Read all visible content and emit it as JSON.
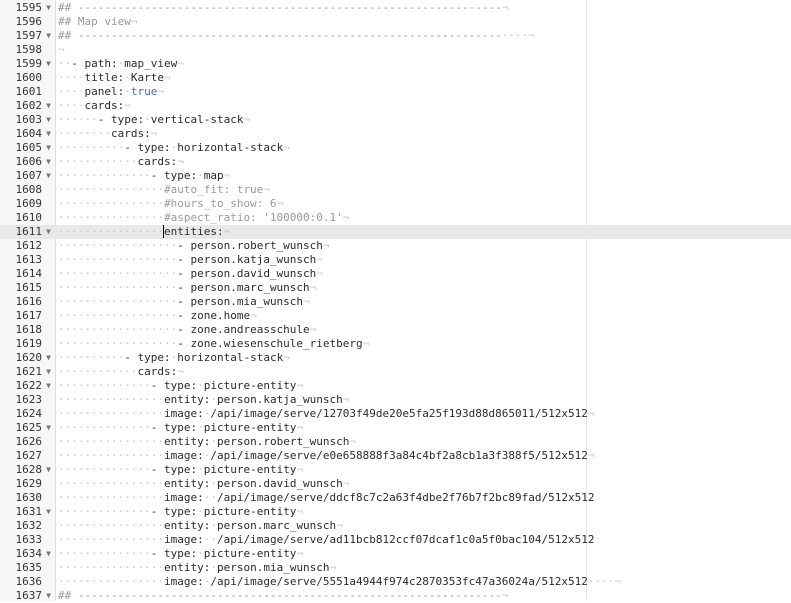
{
  "editor": {
    "lines": [
      {
        "n": "1595",
        "fold": true,
        "indent": 0,
        "c": "## ----------------------------------------------------------------",
        "eol": "¬"
      },
      {
        "n": "1596",
        "fold": false,
        "indent": 0,
        "c": "## Map view",
        "eol": "¬"
      },
      {
        "n": "1597",
        "fold": true,
        "indent": 0,
        "c": "## ----------------------------------------------------------------",
        "eol": "····¬"
      },
      {
        "n": "1598",
        "fold": false,
        "indent": 0,
        "eol": "¬"
      },
      {
        "n": "1599",
        "fold": true,
        "indent": 1,
        "d": "- ",
        "k": "path",
        "v": "map_view",
        "eol": "¬"
      },
      {
        "n": "1600",
        "fold": false,
        "indent": 2,
        "k": "title",
        "v": "Karte",
        "eol": "¬"
      },
      {
        "n": "1601",
        "fold": false,
        "indent": 2,
        "k": "panel",
        "b": "true",
        "eol": "¬"
      },
      {
        "n": "1602",
        "fold": true,
        "indent": 2,
        "k": "cards",
        "eol": "¬"
      },
      {
        "n": "1603",
        "fold": true,
        "indent": 3,
        "d": "- ",
        "k": "type",
        "v": "vertical-stack",
        "eol": "¬"
      },
      {
        "n": "1604",
        "fold": true,
        "indent": 4,
        "k": "cards",
        "eol": "¬"
      },
      {
        "n": "1605",
        "fold": true,
        "indent": 5,
        "d": "- ",
        "k": "type",
        "v": "horizontal-stack",
        "eol": "¬"
      },
      {
        "n": "1606",
        "fold": true,
        "indent": 6,
        "k": "cards",
        "eol": "¬"
      },
      {
        "n": "1607",
        "fold": true,
        "indent": 7,
        "d": "- ",
        "k": "type",
        "v": "map",
        "eol": "¬"
      },
      {
        "n": "1608",
        "fold": false,
        "indent": 8,
        "c": "#auto_fit: true",
        "eol": "¬"
      },
      {
        "n": "1609",
        "fold": false,
        "indent": 8,
        "c": "#hours_to_show: 6",
        "eol": "¬"
      },
      {
        "n": "1610",
        "fold": false,
        "indent": 8,
        "c": "#aspect_ratio: '100000:0.1'",
        "eol": "¬"
      },
      {
        "n": "1611",
        "fold": true,
        "indent": 8,
        "k": "entities",
        "active": true,
        "caret": true,
        "eol": "¬"
      },
      {
        "n": "1612",
        "fold": false,
        "indent": 9,
        "d": "- ",
        "v": "person.robert_wunsch",
        "eol": "¬"
      },
      {
        "n": "1613",
        "fold": false,
        "indent": 9,
        "d": "- ",
        "v": "person.katja_wunsch",
        "eol": "¬"
      },
      {
        "n": "1614",
        "fold": false,
        "indent": 9,
        "d": "- ",
        "v": "person.david_wunsch",
        "eol": "¬"
      },
      {
        "n": "1615",
        "fold": false,
        "indent": 9,
        "d": "- ",
        "v": "person.marc_wunsch",
        "eol": "¬"
      },
      {
        "n": "1616",
        "fold": false,
        "indent": 9,
        "d": "- ",
        "v": "person.mia_wunsch",
        "eol": "¬"
      },
      {
        "n": "1617",
        "fold": false,
        "indent": 9,
        "d": "- ",
        "v": "zone.home",
        "eol": "¬"
      },
      {
        "n": "1618",
        "fold": false,
        "indent": 9,
        "d": "- ",
        "v": "zone.andreasschule",
        "eol": "¬"
      },
      {
        "n": "1619",
        "fold": false,
        "indent": 9,
        "d": "- ",
        "v": "zone.wiesenschule_rietberg",
        "eol": "¬"
      },
      {
        "n": "1620",
        "fold": true,
        "indent": 5,
        "d": "- ",
        "k": "type",
        "v": "horizontal-stack",
        "eol": "¬"
      },
      {
        "n": "1621",
        "fold": true,
        "indent": 6,
        "k": "cards",
        "eol": "¬"
      },
      {
        "n": "1622",
        "fold": true,
        "indent": 7,
        "d": "- ",
        "k": "type",
        "v": "picture-entity",
        "eol": "¬"
      },
      {
        "n": "1623",
        "fold": false,
        "indent": 8,
        "k": "entity",
        "v": "person.katja_wunsch",
        "eol": "¬"
      },
      {
        "n": "1624",
        "fold": false,
        "indent": 8,
        "k": "image",
        "v": "/api/image/serve/12703f49de20e5fa25f193d88d865011/512x512",
        "eol": "¬"
      },
      {
        "n": "1625",
        "fold": true,
        "indent": 7,
        "d": "- ",
        "k": "type",
        "v": "picture-entity",
        "eol": "¬"
      },
      {
        "n": "1626",
        "fold": false,
        "indent": 8,
        "k": "entity",
        "v": "person.robert_wunsch",
        "eol": "¬"
      },
      {
        "n": "1627",
        "fold": false,
        "indent": 8,
        "k": "image",
        "v": "/api/image/serve/e0e658888f3a84c4bf2a8cb1a3f388f5/512x512",
        "eol": "¬"
      },
      {
        "n": "1628",
        "fold": true,
        "indent": 7,
        "d": "- ",
        "k": "type",
        "v": "picture-entity",
        "eol": "¬"
      },
      {
        "n": "1629",
        "fold": false,
        "indent": 8,
        "k": "entity",
        "v": "person.david_wunsch",
        "eol": "¬"
      },
      {
        "n": "1630",
        "fold": false,
        "indent": 8,
        "k": "image",
        "sp": "··",
        "v": "/api/image/serve/ddcf8c7c2a63f4dbe2f76b7f2bc89fad/512x512",
        "eol": ""
      },
      {
        "n": "1631",
        "fold": true,
        "indent": 7,
        "d": "- ",
        "k": "type",
        "v": "picture-entity",
        "eol": "¬"
      },
      {
        "n": "1632",
        "fold": false,
        "indent": 8,
        "k": "entity",
        "v": "person.marc_wunsch",
        "eol": "¬"
      },
      {
        "n": "1633",
        "fold": false,
        "indent": 8,
        "k": "image",
        "sp": "··",
        "v": "/api/image/serve/ad11bcb812ccf07dcaf1c0a5f0bac104/512x512",
        "eol": ""
      },
      {
        "n": "1634",
        "fold": true,
        "indent": 7,
        "d": "- ",
        "k": "type",
        "v": "picture-entity",
        "eol": "¬"
      },
      {
        "n": "1635",
        "fold": false,
        "indent": 8,
        "k": "entity",
        "v": "person.mia_wunsch",
        "eol": "¬"
      },
      {
        "n": "1636",
        "fold": false,
        "indent": 8,
        "k": "image",
        "v": "/api/image/serve/5551a4944f974c2870353fc47a36024a/512x512",
        "eol": "····¬"
      },
      {
        "n": "1637",
        "fold": true,
        "indent": 0,
        "c": "## ----------------------------------------------------------------",
        "eol": "¬"
      }
    ]
  }
}
